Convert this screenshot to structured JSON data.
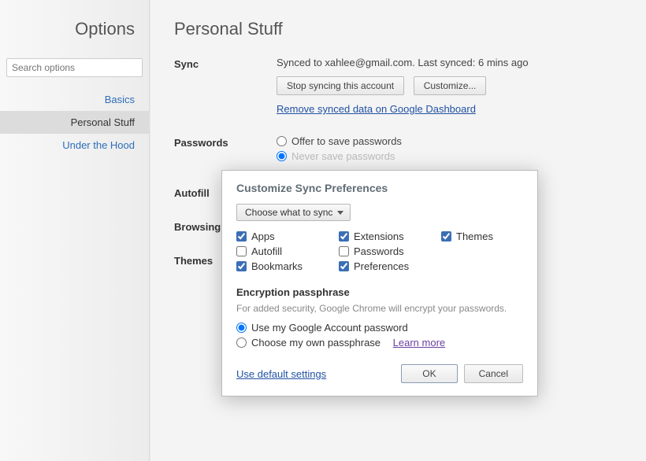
{
  "sidebar": {
    "title": "Options",
    "search_placeholder": "Search options",
    "items": [
      {
        "label": "Basics",
        "active": false
      },
      {
        "label": "Personal Stuff",
        "active": true
      },
      {
        "label": "Under the Hood",
        "active": false
      }
    ]
  },
  "page_title": "Personal Stuff",
  "sections": {
    "sync": {
      "label": "Sync",
      "status": "Synced to xahlee@gmail.com. Last synced: 6 mins ago",
      "stop_button": "Stop syncing this account",
      "customize_button": "Customize...",
      "remove_link": "Remove synced data on Google Dashboard"
    },
    "passwords": {
      "label": "Passwords",
      "option_offer": "Offer to save passwords",
      "option_never": "Never save passwords"
    },
    "autofill": {
      "label": "Autofill"
    },
    "browsing": {
      "label": "Browsing"
    },
    "themes": {
      "label": "Themes"
    }
  },
  "dialog": {
    "title": "Customize Sync Preferences",
    "dropdown": "Choose what to sync",
    "checks": {
      "apps": {
        "label": "Apps",
        "checked": true
      },
      "autofill": {
        "label": "Autofill",
        "checked": false
      },
      "bookmarks": {
        "label": "Bookmarks",
        "checked": true
      },
      "extensions": {
        "label": "Extensions",
        "checked": true
      },
      "passwords": {
        "label": "Passwords",
        "checked": false
      },
      "preferences": {
        "label": "Preferences",
        "checked": true
      },
      "themes": {
        "label": "Themes",
        "checked": true
      }
    },
    "encryption": {
      "heading": "Encryption passphrase",
      "description": "For added security, Google Chrome will encrypt your passwords.",
      "option_google": "Use my Google Account password",
      "option_own": "Choose my own passphrase",
      "learn_more": "Learn more"
    },
    "default_link": "Use default settings",
    "ok": "OK",
    "cancel": "Cancel"
  }
}
